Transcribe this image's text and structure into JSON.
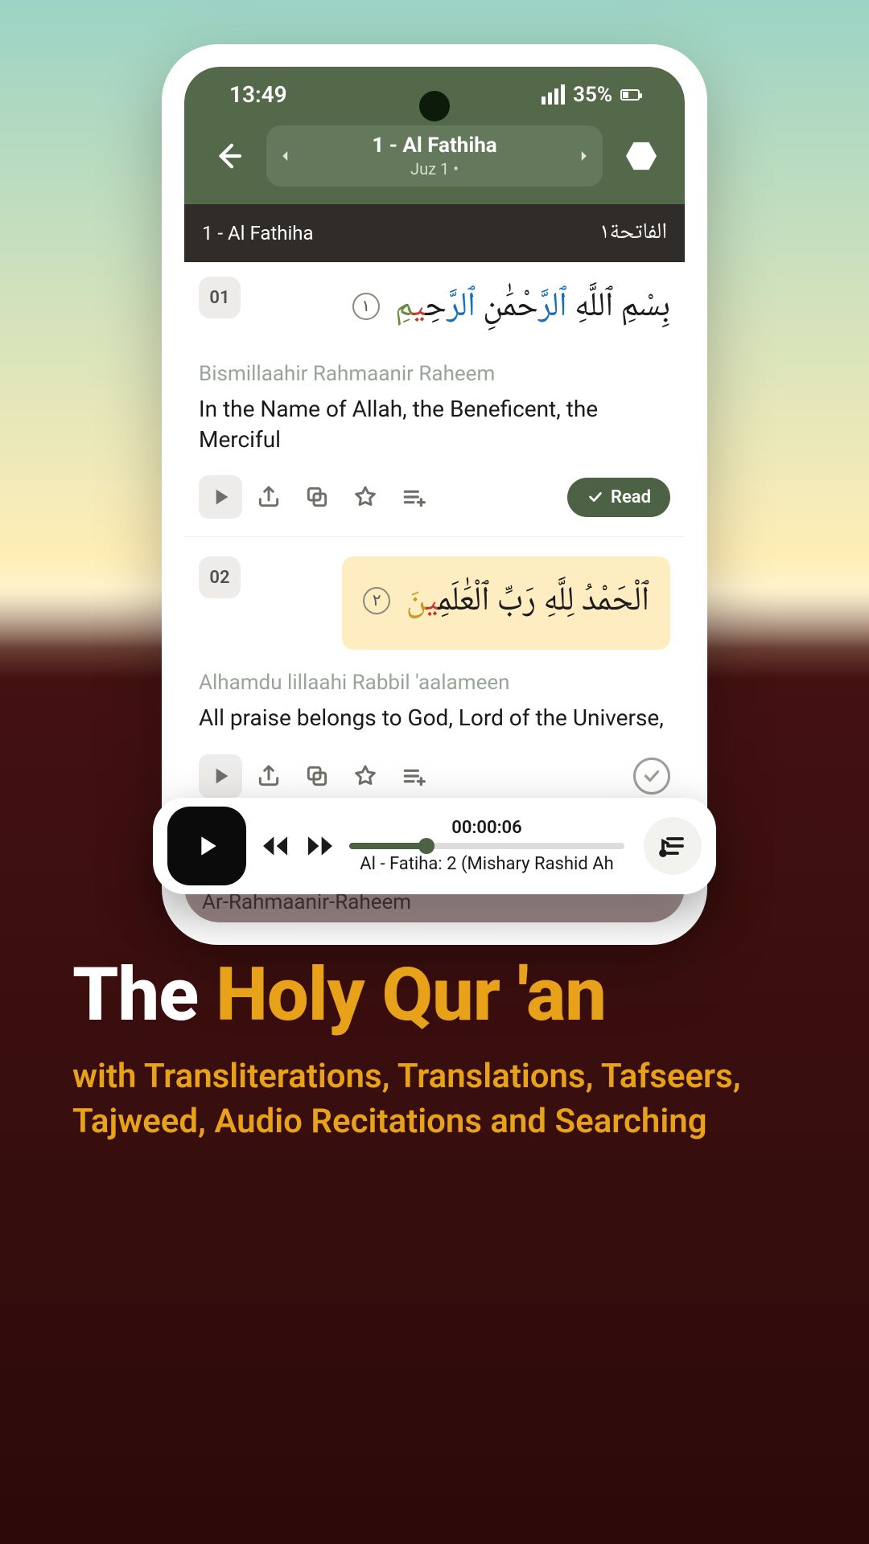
{
  "status": {
    "time": "13:49",
    "battery": "35%"
  },
  "header": {
    "title": "1 - Al Fathiha",
    "subtitle": "Juz 1 •"
  },
  "subheader": {
    "left": "1 - Al Fathiha",
    "right_ar": "الفاتحة١"
  },
  "verses": [
    {
      "num": "01",
      "arabic_html": "بِسْمِ ٱللَّهِ <span class='hl-blue'>ٱلرَّ</span>حْمَٰنِ <span class='hl-blue'>ٱلرَّ</span>حِ<span class='hl-red'>ي</span><span class='hl-olive'>مِ</span>",
      "endmark": "١",
      "highlight": false,
      "translit": "Bismillaahir Rahmaanir Raheem",
      "translation": "In the Name of Allah, the Beneficent, the Merciful",
      "read_label": "Read",
      "read_done": true
    },
    {
      "num": "02",
      "arabic_html": "ٱلْحَمْدُ لِلَّهِ رَبِّ ٱلْعَٰلَمِ<span class='hl-red'>ي</span><span class='hl-gold'>نَ</span>",
      "endmark": "٢",
      "highlight": true,
      "translit": "Alhamdu lillaahi Rabbil 'aalameen",
      "translation": "All praise belongs to God, Lord of the Universe,",
      "read_done": false
    }
  ],
  "below_translit": "Ar-Rahmaanir-Raheem",
  "player": {
    "time": "00:00:06",
    "now_playing": "Al - Fatiha: 2 (Mishary Rashid Ah",
    "progress_pct": 28
  },
  "promo": {
    "word1": "The ",
    "word2": "Holy Qur 'an",
    "sub": "with Transliterations, Translations, Tafseers, Tajweed, Audio Recitations and Searching"
  }
}
